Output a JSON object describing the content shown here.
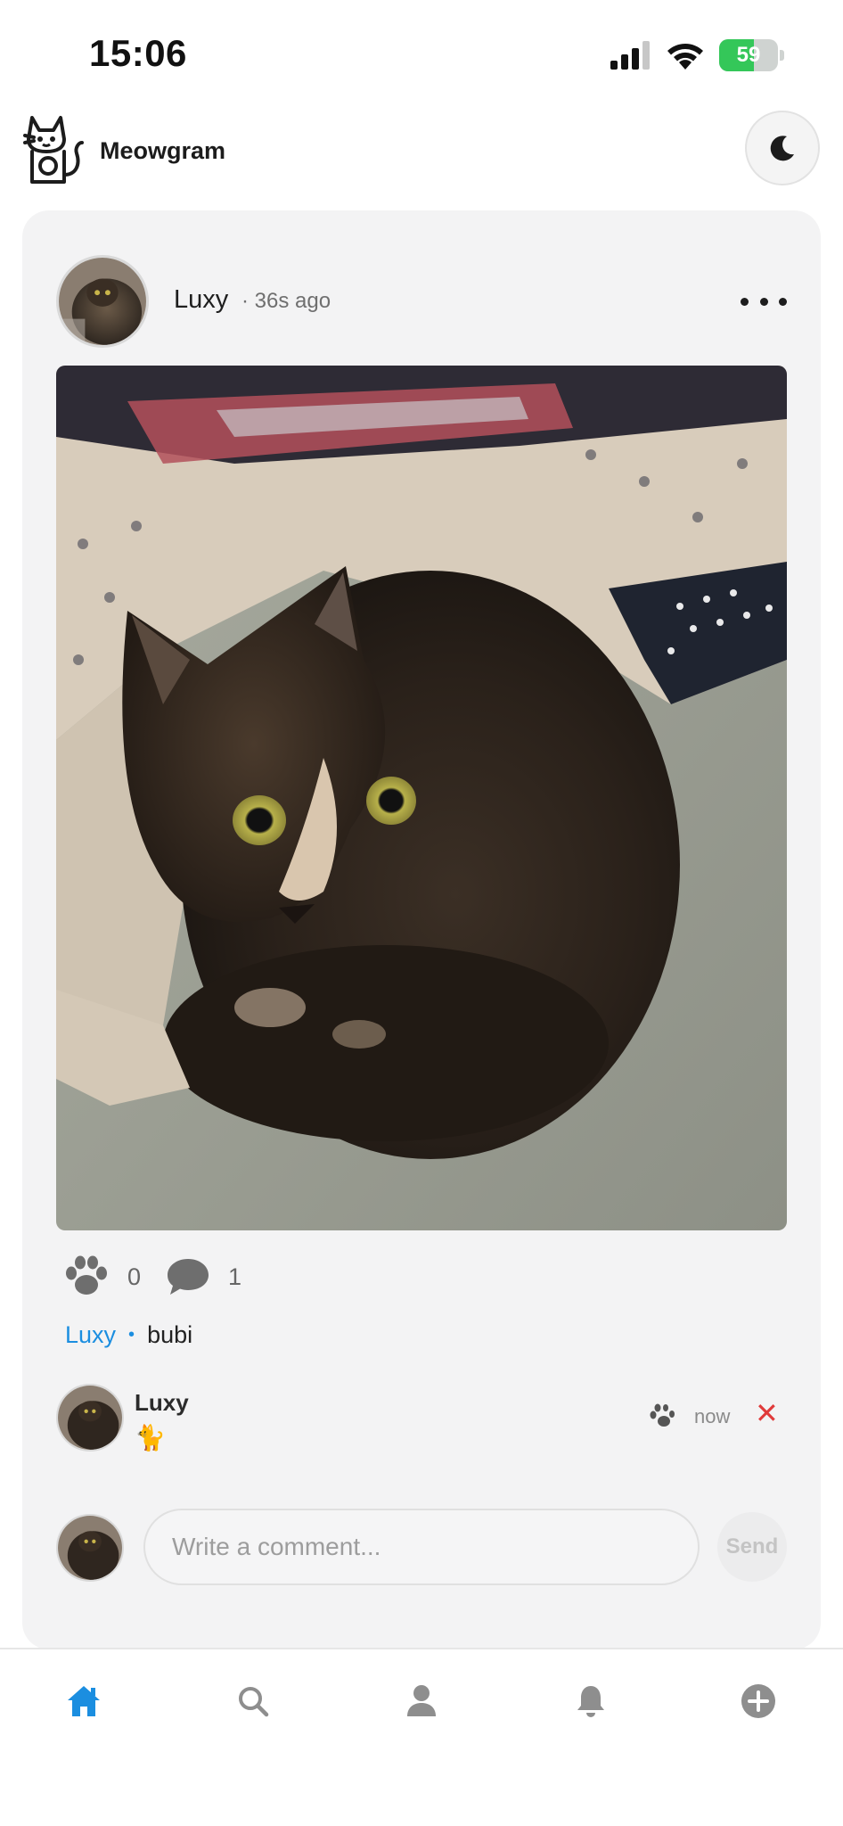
{
  "status_bar": {
    "time": "15:06",
    "battery_percent": "59"
  },
  "app": {
    "name": "Meowgram"
  },
  "post": {
    "author": "Luxy",
    "time_ago": "· 36s ago",
    "likes": "0",
    "comments_count": "1",
    "caption_user": "Luxy",
    "caption_dot": "•",
    "caption_text": "bubi"
  },
  "comments": [
    {
      "user": "Luxy",
      "text": "🐈",
      "time": "now",
      "delete": "✕"
    }
  ],
  "compose": {
    "placeholder": "Write a comment...",
    "send_label": "Send"
  },
  "nav": {
    "items": [
      {
        "icon": "home-icon",
        "active": true
      },
      {
        "icon": "search-icon",
        "active": false
      },
      {
        "icon": "profile-icon",
        "active": false
      },
      {
        "icon": "bell-icon",
        "active": false
      },
      {
        "icon": "plus-circle-icon",
        "active": false
      }
    ]
  },
  "colors": {
    "accent": "#1b8ee0",
    "card_bg": "#f3f3f4",
    "delete": "#e03a3a",
    "battery": "#34c759"
  }
}
